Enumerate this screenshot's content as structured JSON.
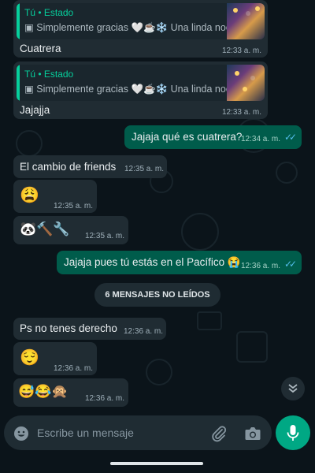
{
  "colors": {
    "accent": "#00a884",
    "incoming": "#202c33",
    "outgoing": "#005c4b",
    "read_ticks": "#53bdeb",
    "background": "#0b141a"
  },
  "messages": [
    {
      "type": "incoming-reply",
      "reply_author": "Tú • Estado",
      "reply_snippet": "▣ Simplemente gracias 🤍☕❄️ Una linda noche",
      "text": "Cuatrera",
      "time": "12:33 a. m."
    },
    {
      "type": "incoming-reply",
      "reply_author": "Tú • Estado",
      "reply_snippet": "▣ Simplemente gracias 🤍☕❄️ Una linda noche",
      "text": "Jajajja",
      "time": "12:33 a. m."
    },
    {
      "type": "outgoing",
      "text": "Jajaja qué es cuatrera?",
      "time": "12:34 a. m.",
      "status": "read"
    },
    {
      "type": "incoming",
      "text": "El cambio de friends",
      "time": "12:35 a. m."
    },
    {
      "type": "incoming",
      "text": "😩",
      "time": "12:35 a. m."
    },
    {
      "type": "incoming",
      "text": "🐼🔨🔧",
      "time": "12:35 a. m."
    },
    {
      "type": "outgoing",
      "text": "Jajaja pues tú estás en el Pacífico 😭",
      "time": "12:36 a. m.",
      "status": "read"
    },
    {
      "type": "incoming",
      "text": "Ps no tenes derecho",
      "time": "12:36 a. m."
    },
    {
      "type": "incoming",
      "text": "😌",
      "time": "12:36 a. m."
    },
    {
      "type": "incoming",
      "text": "😅😂🙊",
      "time": "12:36 a. m."
    }
  ],
  "unread_divider": "6 MENSAJES NO LEÍDOS",
  "composer": {
    "placeholder": "Escribe un mensaje",
    "emoji_icon": "emoji-icon",
    "attach_icon": "paperclip-icon",
    "camera_icon": "camera-icon",
    "mic_icon": "microphone-icon"
  },
  "scroll_down_icon": "double-chevron-down-icon"
}
